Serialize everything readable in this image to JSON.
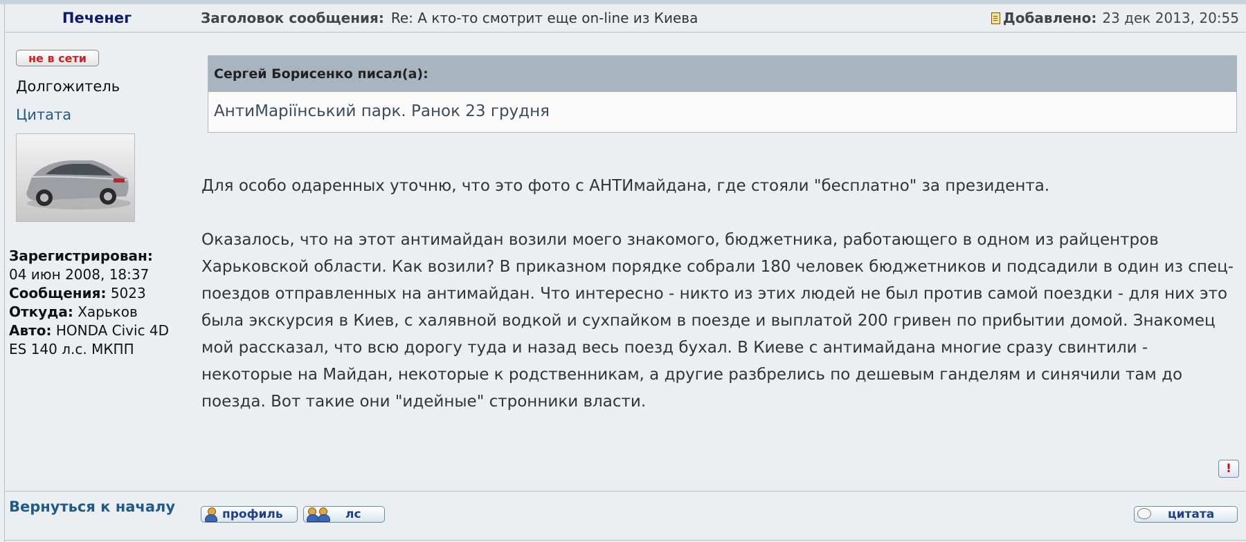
{
  "author": {
    "name": "Печенег",
    "status_button": "не в сети",
    "rank": "Долгожитель",
    "quote_link": "Цитата",
    "stats": {
      "registered_label": "Зарегистрирован:",
      "registered_value": "04 июн 2008, 18:37",
      "posts_label": "Сообщения:",
      "posts_value": "5023",
      "from_label": "Откуда:",
      "from_value": "Харьков",
      "car_label": "Авто:",
      "car_value": "HONDA Civic 4D ES 140 л.с. МКПП"
    },
    "back_to_top": "Вернуться к началу"
  },
  "post": {
    "subject_label": "Заголовок сообщения:",
    "subject": "Re: А кто-то смотрит еще on-line из Киева",
    "added_label": "Добавлено:",
    "added_value": "23 дек 2013, 20:55",
    "quote": {
      "author": "Сергей Борисенко писал(а):",
      "text": "АнтиМаріїнський парк. Ранок 23 грудня"
    },
    "paragraphs": [
      "Для особо одаренных уточню, что это фото с АНТИмайдана, где стояли \"бесплатно\" за президента.",
      "Оказалось, что на этот антимайдан возили моего знакомого, бюджетника, работающего в одном из райцентров Харьковской области. Как возили? В приказном порядке собрали 180 человек бюджетников и подсадили в один из спец-поездов отправленных на антимайдан. Что интересно - никто из этих людей не был против самой поездки - для них это была экскурсия в Киев, с халявной водкой и сухпайком в поезде и выплатой 200 гривен по прибытии домой. Знакомец мой рассказал, что всю дорогу туда и назад весь поезд бухал. В Киеве с антимайдана многие сразу свинтили - некоторые на Майдан, некоторые к родственникам, а другие разбрелись по дешевым ганделям и синячили там до поезда. Вот такие они \"идейные\" стронники власти."
    ],
    "report_icon": "!"
  },
  "buttons": {
    "profile": "профиль",
    "pm": "лс",
    "quote": "цитата"
  }
}
